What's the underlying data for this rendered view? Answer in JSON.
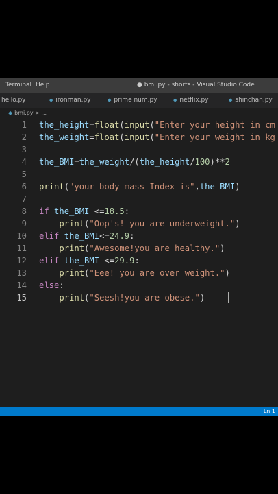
{
  "menu": {
    "terminal": "Terminal",
    "help": "Help"
  },
  "window_title": "● bmi.py - shorts - Visual Studio Code",
  "tabs": [
    {
      "label": "hello.py",
      "icon": "python-icon"
    },
    {
      "label": "ironman.py",
      "icon": "python-icon"
    },
    {
      "label": "prime num.py",
      "icon": "python-icon"
    },
    {
      "label": "netflix.py",
      "icon": "python-icon"
    },
    {
      "label": "shinchan.py",
      "icon": "python-icon"
    }
  ],
  "breadcrumb": "bmi.py > ...",
  "code_lines": [
    "1",
    "2",
    "3",
    "4",
    "5",
    "6",
    "7",
    "8",
    "9",
    "10",
    "11",
    "12",
    "13",
    "14",
    "15"
  ],
  "code": {
    "l1": {
      "a": "the_height",
      "b": "=",
      "c": "float",
      "d": "(",
      "e": "input",
      "f": "(",
      "g": "\"Enter your height in cm"
    },
    "l2": {
      "a": "the_weight",
      "b": "=",
      "c": "float",
      "d": "(",
      "e": "input",
      "f": "(",
      "g": "\"Enter your weight in kg"
    },
    "l4": {
      "a": "the_BMI",
      "b": "=",
      "c": "the_weight",
      "d": "/(",
      "e": "the_height",
      "f": "/",
      "g": "100",
      "h": ")**",
      "i": "2"
    },
    "l6": {
      "a": "print",
      "b": "(",
      "c": "\"your body mass Index is\"",
      "d": ",",
      "e": "the_BMI",
      "f": ")"
    },
    "l8": {
      "a": "if",
      "b": " ",
      "c": "the_BMI",
      "d": " <=",
      "e": "18.5",
      "f": ":"
    },
    "l9": {
      "a": "print",
      "b": "(",
      "c": "\"Oop's! you are underweight.\"",
      "d": ")"
    },
    "l10": {
      "a": "elif",
      "b": " ",
      "c": "the_BMI",
      "d": "<=",
      "e": "24.9",
      "f": ":"
    },
    "l11": {
      "a": "print",
      "b": "(",
      "c": "\"Awesome!you are healthy.\"",
      "d": ")"
    },
    "l12": {
      "a": "elif",
      "b": " ",
      "c": "the_BMI",
      "d": " <=",
      "e": "29.9",
      "f": ":"
    },
    "l13": {
      "a": "print",
      "b": "(",
      "c": "\"Eee! you are over weight.\"",
      "d": ")"
    },
    "l14": {
      "a": "else",
      "b": ":"
    },
    "l15": {
      "a": "print",
      "b": "(",
      "c": "\"Seesh!you are obese.\"",
      "d": ")"
    }
  },
  "status": {
    "position": "Ln 1"
  },
  "colors": {
    "background": "#1e1e1e",
    "titlebar": "#3c3c3c",
    "statusbar": "#007acc",
    "function": "#dcdcaa",
    "variable": "#9cdcfe",
    "string": "#ce9178",
    "number": "#b5cea8",
    "keyword": "#c586c0"
  }
}
